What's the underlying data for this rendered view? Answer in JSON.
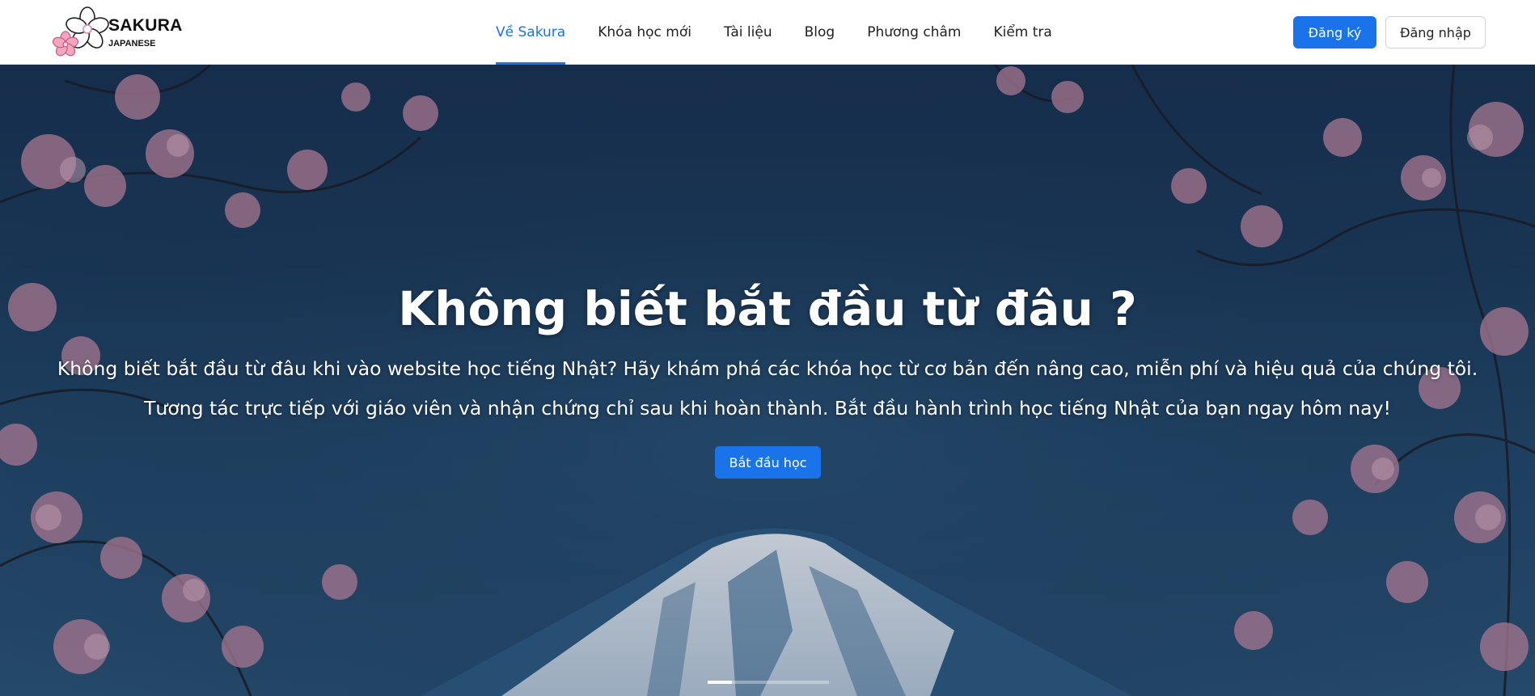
{
  "brand": {
    "name": "SAKURA",
    "subtitle": "JAPANESE",
    "logo_icon": "sakura-flower-icon"
  },
  "nav": {
    "items": [
      {
        "label": "Về Sakura",
        "active": true
      },
      {
        "label": "Khóa học mới",
        "active": false
      },
      {
        "label": "Tài liệu",
        "active": false
      },
      {
        "label": "Blog",
        "active": false
      },
      {
        "label": "Phương châm",
        "active": false
      },
      {
        "label": "Kiểm tra",
        "active": false
      }
    ],
    "register_label": "Đăng ký",
    "login_label": "Đăng nhập"
  },
  "hero": {
    "title": "Không biết bắt đầu từ đâu ?",
    "line1": "Không biết bắt đầu từ đâu khi vào website học tiếng Nhật? Hãy khám phá các khóa học từ cơ bản đến nâng cao, miễn phí và hiệu quả của chúng tôi.",
    "line2": "Tương tác trực tiếp với giáo viên và nhận chứng chỉ sau khi hoàn thành. Bắt đầu hành trình học tiếng Nhật của bạn ngay hôm nay!",
    "cta_label": "Bắt đầu học",
    "slide_count": 5,
    "active_slide": 1
  },
  "colors": {
    "accent": "#1a73e8",
    "hero_bg": "#1c3b5c",
    "text_dark": "#222222"
  }
}
